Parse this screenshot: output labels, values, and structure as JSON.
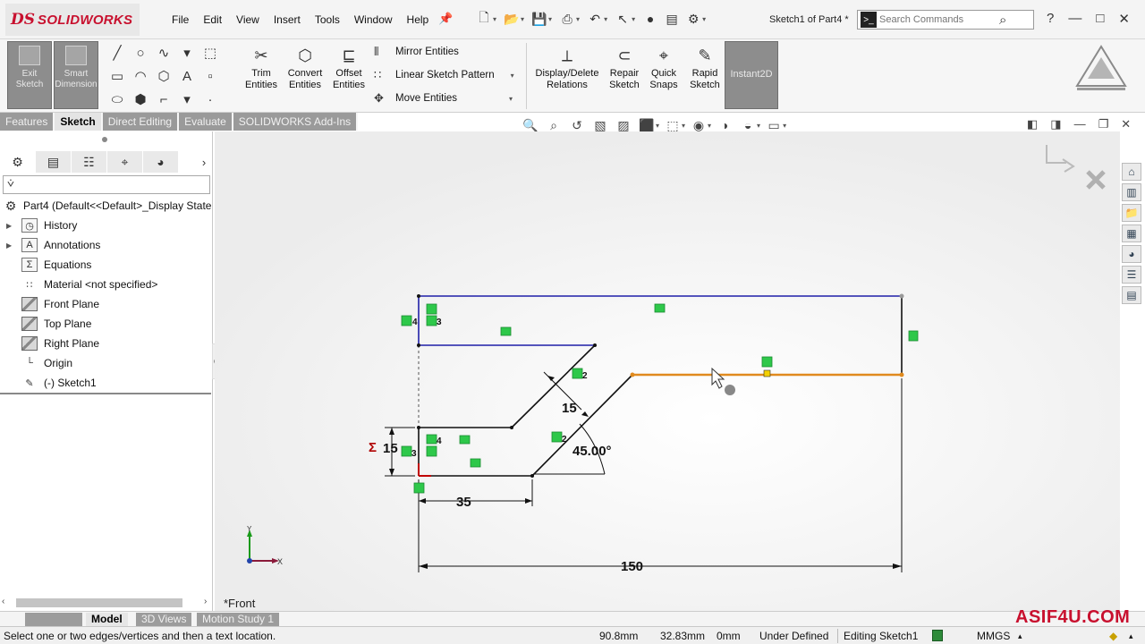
{
  "app": {
    "logo_ds": "DS",
    "logo_name": "SOLIDWORKS",
    "document_title": "Sketch1 of Part4 *",
    "search_placeholder": "Search Commands"
  },
  "menus": [
    "File",
    "Edit",
    "View",
    "Insert",
    "Tools",
    "Window",
    "Help"
  ],
  "command_manager": {
    "exit_sketch": "Exit Sketch",
    "smart_dimension": "Smart Dimension",
    "trim_entities": "Trim Entities",
    "convert_entities": "Convert Entities",
    "offset_entities": "Offset Entities",
    "mirror_entities": "Mirror Entities",
    "linear_sketch_pattern": "Linear Sketch Pattern",
    "move_entities": "Move Entities",
    "display_delete_relations": "Display/Delete Relations",
    "repair_sketch": "Repair Sketch",
    "quick_snaps": "Quick Snaps",
    "rapid_sketch": "Rapid Sketch",
    "instant_2d": "Instant2D"
  },
  "tabs": [
    {
      "label": "Features",
      "active": false
    },
    {
      "label": "Sketch",
      "active": true
    },
    {
      "label": "Direct Editing",
      "active": false
    },
    {
      "label": "Evaluate",
      "active": false
    },
    {
      "label": "SOLIDWORKS Add-Ins",
      "active": false
    }
  ],
  "feature_tree": {
    "root": "Part4  (Default<<Default>_Display State",
    "items": [
      {
        "label": "History",
        "icon": "history-icon",
        "expandable": true
      },
      {
        "label": "Annotations",
        "icon": "annotations-icon",
        "expandable": true
      },
      {
        "label": "Equations",
        "icon": "equations-icon",
        "expandable": false
      },
      {
        "label": "Material <not specified>",
        "icon": "material-icon",
        "expandable": false
      },
      {
        "label": "Front Plane",
        "icon": "plane-icon",
        "expandable": false
      },
      {
        "label": "Top Plane",
        "icon": "plane-icon",
        "expandable": false
      },
      {
        "label": "Right Plane",
        "icon": "plane-icon",
        "expandable": false
      },
      {
        "label": "Origin",
        "icon": "origin-icon",
        "expandable": false
      },
      {
        "label": "(-) Sketch1",
        "icon": "sketch-icon",
        "expandable": false
      }
    ]
  },
  "sketch": {
    "dimensions": {
      "height_left": "15",
      "width_bottom": "35",
      "offset_diag": "15",
      "angle": "45.00°",
      "overall_width": "150"
    },
    "relation_labels": [
      "4",
      "3",
      "2",
      "4",
      "3",
      "2"
    ],
    "triad_x": "X",
    "triad_y": "Y",
    "view_name": "*Front",
    "colors": {
      "selected_line": "#e08a1e",
      "fully_defined": "#1f1fa8",
      "under_defined": "#000000",
      "relation_box": "#2ec84a",
      "dimension_sigma": "#b00000"
    }
  },
  "bottom_tabs": {
    "model": "Model",
    "views_3d": "3D Views",
    "motion_study": "Motion Study 1"
  },
  "watermark": "ASIF4U.COM",
  "status_bar": {
    "message": "Select one or two edges/vertices and then a text location.",
    "x": "90.8mm",
    "y": "32.83mm",
    "z": "0mm",
    "definition": "Under Defined",
    "mode": "Editing Sketch1",
    "units": "MMGS"
  }
}
